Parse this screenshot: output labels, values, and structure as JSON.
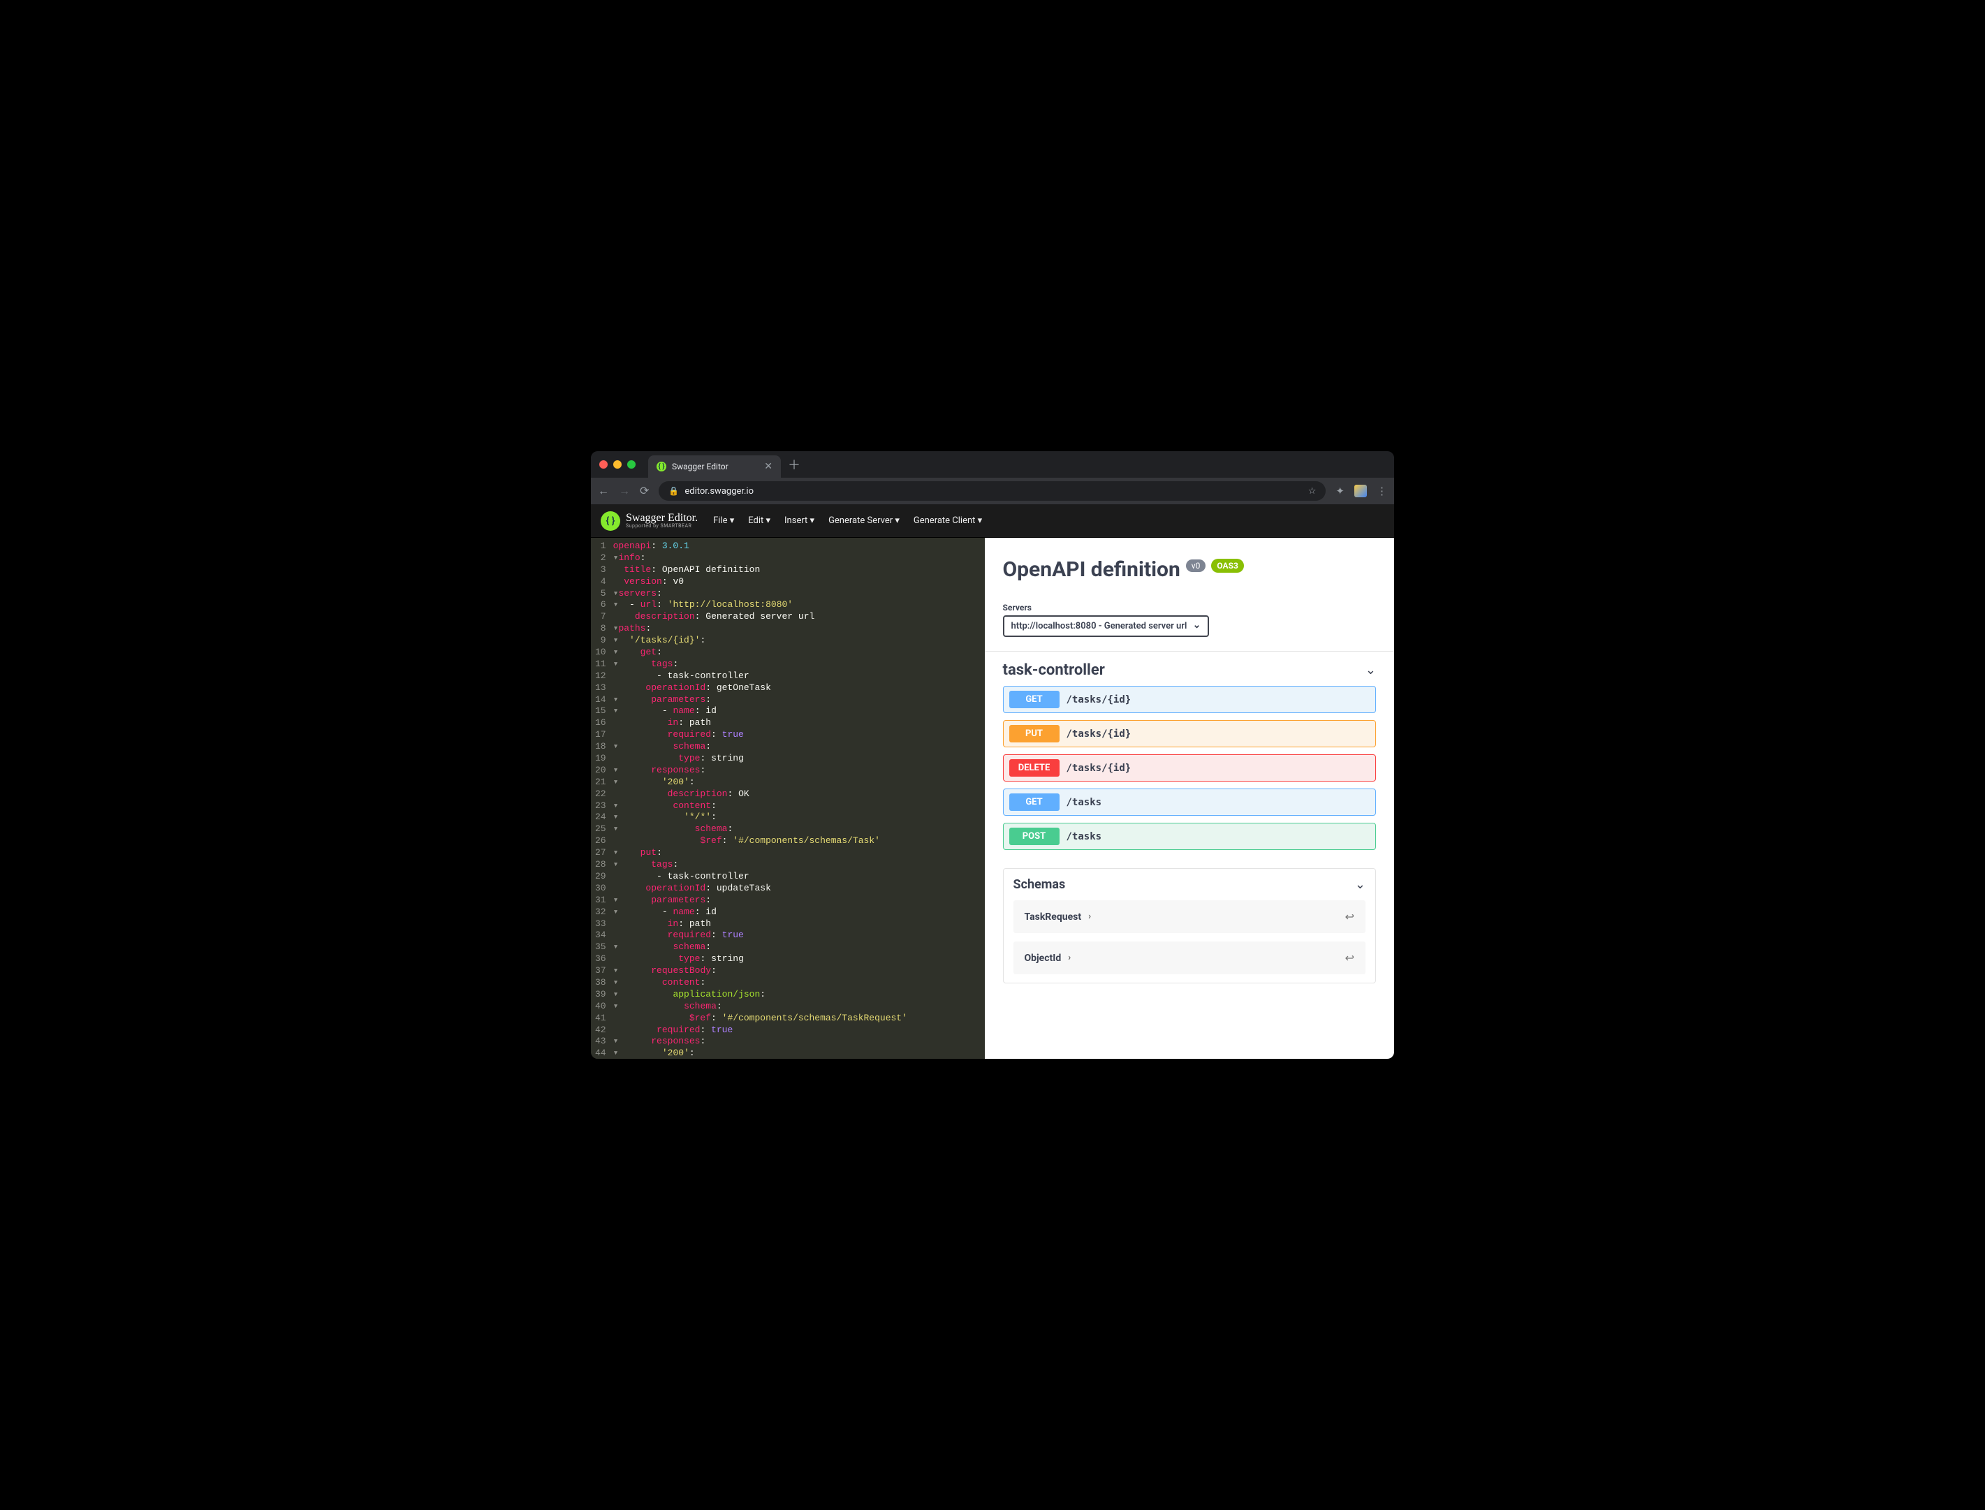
{
  "browser": {
    "tab_title": "Swagger Editor",
    "url_display": "editor.swagger.io"
  },
  "app": {
    "brand_line1": "Swagger Editor.",
    "brand_line2": "Supported by SMARTBEAR",
    "menu": {
      "file": "File ▾",
      "edit": "Edit ▾",
      "insert": "Insert ▾",
      "gen_server": "Generate Server ▾",
      "gen_client": "Generate Client ▾"
    }
  },
  "editor": {
    "lines": [
      {
        "n": "1",
        "html": "<span class='k'>openapi</span><span class='c'>: </span><span class='p'>3.0.1</span>"
      },
      {
        "n": "2",
        "html": "<span class='fold'>▾</span><span class='k'>info</span><span class='c'>:</span>"
      },
      {
        "n": "3",
        "html": "  <span class='k'>title</span><span class='c'>: </span><span class='c'>OpenAPI definition</span>"
      },
      {
        "n": "4",
        "html": "  <span class='k'>version</span><span class='c'>: </span><span class='c'>v0</span>"
      },
      {
        "n": "5",
        "html": "<span class='fold'>▾</span><span class='k'>servers</span><span class='c'>:</span>"
      },
      {
        "n": "6",
        "html": "<span class='fold'>▾</span>  <span class='c'>- </span><span class='k'>url</span><span class='c'>: </span><span class='s'>'http://localhost:8080'</span>"
      },
      {
        "n": "7",
        "html": "    <span class='k'>description</span><span class='c'>: </span><span class='c'>Generated server url</span>"
      },
      {
        "n": "8",
        "html": "<span class='fold'>▾</span><span class='k'>paths</span><span class='c'>:</span>"
      },
      {
        "n": "9",
        "html": "<span class='fold'>▾</span>  <span class='s'>'/tasks/{id}'</span><span class='c'>:</span>"
      },
      {
        "n": "10",
        "html": "<span class='fold'>▾</span>    <span class='k'>get</span><span class='c'>:</span>"
      },
      {
        "n": "11",
        "html": "<span class='fold'>▾</span>      <span class='k'>tags</span><span class='c'>:</span>"
      },
      {
        "n": "12",
        "html": "        <span class='c'>- task-controller</span>"
      },
      {
        "n": "13",
        "html": "      <span class='k'>operationId</span><span class='c'>: </span><span class='c'>getOneTask</span>"
      },
      {
        "n": "14",
        "html": "<span class='fold'>▾</span>      <span class='k'>parameters</span><span class='c'>:</span>"
      },
      {
        "n": "15",
        "html": "<span class='fold'>▾</span>        <span class='c'>- </span><span class='k'>name</span><span class='c'>: </span><span class='c'>id</span>"
      },
      {
        "n": "16",
        "html": "          <span class='k'>in</span><span class='c'>: </span><span class='c'>path</span>"
      },
      {
        "n": "17",
        "html": "          <span class='k'>required</span><span class='c'>: </span><span class='v'>true</span>"
      },
      {
        "n": "18",
        "html": "<span class='fold'>▾</span>          <span class='k'>schema</span><span class='c'>:</span>"
      },
      {
        "n": "19",
        "html": "            <span class='k'>type</span><span class='c'>: </span><span class='c'>string</span>"
      },
      {
        "n": "20",
        "html": "<span class='fold'>▾</span>      <span class='k'>responses</span><span class='c'>:</span>"
      },
      {
        "n": "21",
        "html": "<span class='fold'>▾</span>        <span class='s'>'200'</span><span class='c'>:</span>"
      },
      {
        "n": "22",
        "html": "          <span class='k'>description</span><span class='c'>: </span><span class='c'>OK</span>"
      },
      {
        "n": "23",
        "html": "<span class='fold'>▾</span>          <span class='k'>content</span><span class='c'>:</span>"
      },
      {
        "n": "24",
        "html": "<span class='fold'>▾</span>            <span class='s'>'*/*'</span><span class='c'>:</span>"
      },
      {
        "n": "25",
        "html": "<span class='fold'>▾</span>              <span class='k'>schema</span><span class='c'>:</span>"
      },
      {
        "n": "26",
        "html": "                <span class='k'>$ref</span><span class='c'>: </span><span class='s'>'#/components/schemas/Task'</span>"
      },
      {
        "n": "27",
        "html": "<span class='fold'>▾</span>    <span class='k'>put</span><span class='c'>:</span>"
      },
      {
        "n": "28",
        "html": "<span class='fold'>▾</span>      <span class='k'>tags</span><span class='c'>:</span>"
      },
      {
        "n": "29",
        "html": "        <span class='c'>- task-controller</span>"
      },
      {
        "n": "30",
        "html": "      <span class='k'>operationId</span><span class='c'>: </span><span class='c'>updateTask</span>"
      },
      {
        "n": "31",
        "html": "<span class='fold'>▾</span>      <span class='k'>parameters</span><span class='c'>:</span>"
      },
      {
        "n": "32",
        "html": "<span class='fold'>▾</span>        <span class='c'>- </span><span class='k'>name</span><span class='c'>: </span><span class='c'>id</span>"
      },
      {
        "n": "33",
        "html": "          <span class='k'>in</span><span class='c'>: </span><span class='c'>path</span>"
      },
      {
        "n": "34",
        "html": "          <span class='k'>required</span><span class='c'>: </span><span class='v'>true</span>"
      },
      {
        "n": "35",
        "html": "<span class='fold'>▾</span>          <span class='k'>schema</span><span class='c'>:</span>"
      },
      {
        "n": "36",
        "html": "            <span class='k'>type</span><span class='c'>: </span><span class='c'>string</span>"
      },
      {
        "n": "37",
        "html": "<span class='fold'>▾</span>      <span class='k'>requestBody</span><span class='c'>:</span>"
      },
      {
        "n": "38",
        "html": "<span class='fold'>▾</span>        <span class='k'>content</span><span class='c'>:</span>"
      },
      {
        "n": "39",
        "html": "<span class='fold'>▾</span>          <span class='g'>application/json</span><span class='c'>:</span>"
      },
      {
        "n": "40",
        "html": "<span class='fold'>▾</span>            <span class='k'>schema</span><span class='c'>:</span>"
      },
      {
        "n": "41",
        "html": "              <span class='k'>$ref</span><span class='c'>: </span><span class='s'>'#/components/schemas/TaskRequest'</span>"
      },
      {
        "n": "42",
        "html": "        <span class='k'>required</span><span class='c'>: </span><span class='v'>true</span>"
      },
      {
        "n": "43",
        "html": "<span class='fold'>▾</span>      <span class='k'>responses</span><span class='c'>:</span>"
      },
      {
        "n": "44",
        "html": "<span class='fold'>▾</span>        <span class='s'>'200'</span><span class='c'>:</span>"
      }
    ]
  },
  "preview": {
    "title": "OpenAPI definition",
    "version_badge": "v0",
    "oas_badge": "OAS3",
    "servers_label": "Servers",
    "server_selected": "http://localhost:8080 - Generated server url",
    "tag_name": "task-controller",
    "ops": [
      {
        "method": "GET",
        "cls": "get",
        "path": "/tasks/{id}"
      },
      {
        "method": "PUT",
        "cls": "put",
        "path": "/tasks/{id}"
      },
      {
        "method": "DELETE",
        "cls": "delete",
        "path": "/tasks/{id}"
      },
      {
        "method": "GET",
        "cls": "get",
        "path": "/tasks"
      },
      {
        "method": "POST",
        "cls": "post",
        "path": "/tasks"
      }
    ],
    "schemas_title": "Schemas",
    "schemas": [
      {
        "name": "TaskRequest"
      },
      {
        "name": "ObjectId"
      }
    ]
  }
}
